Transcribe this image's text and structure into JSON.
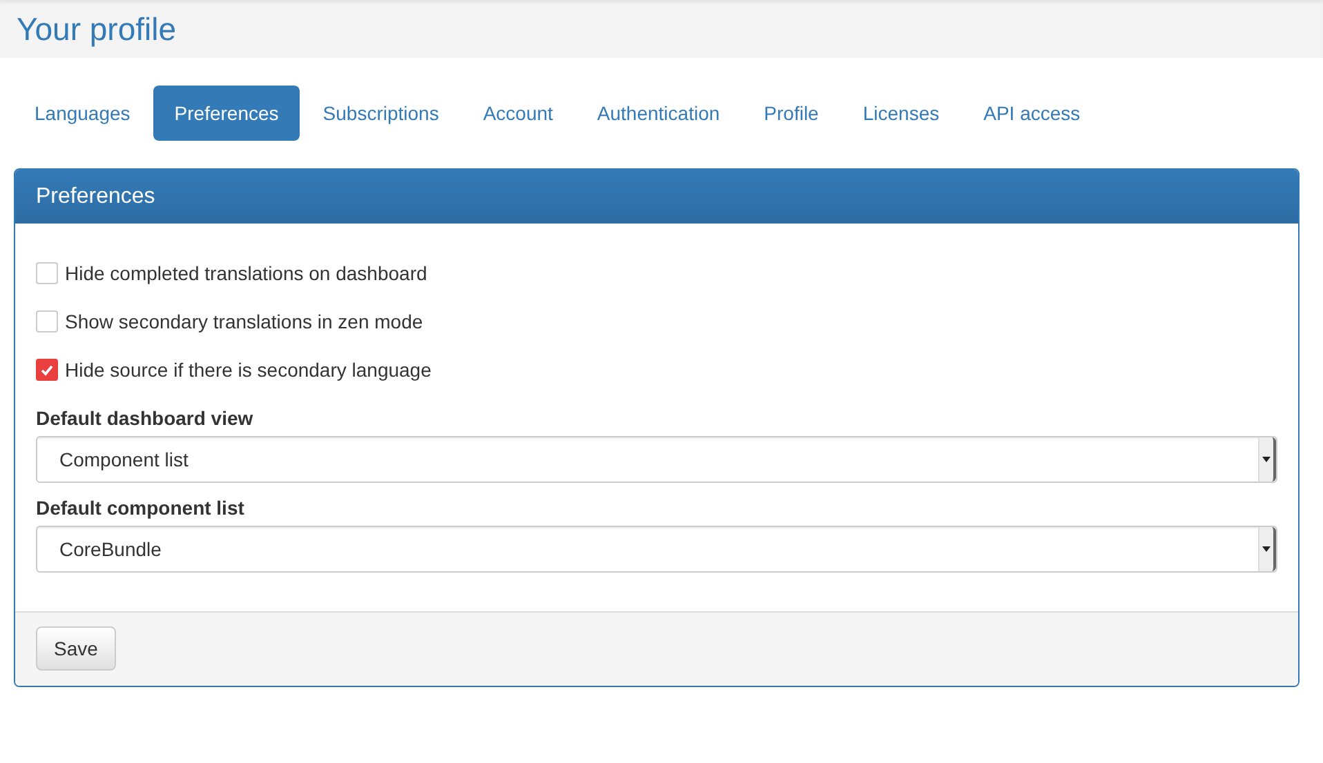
{
  "page": {
    "title": "Your profile"
  },
  "tabs": [
    {
      "label": "Languages",
      "selected": false
    },
    {
      "label": "Preferences",
      "selected": true
    },
    {
      "label": "Subscriptions",
      "selected": false
    },
    {
      "label": "Account",
      "selected": false
    },
    {
      "label": "Authentication",
      "selected": false
    },
    {
      "label": "Profile",
      "selected": false
    },
    {
      "label": "Licenses",
      "selected": false
    },
    {
      "label": "API access",
      "selected": false
    }
  ],
  "panel": {
    "title": "Preferences",
    "checkboxes": [
      {
        "label": "Hide completed translations on dashboard",
        "checked": false
      },
      {
        "label": "Show secondary translations in zen mode",
        "checked": false
      },
      {
        "label": "Hide source if there is secondary language",
        "checked": true
      }
    ],
    "selects": [
      {
        "label": "Default dashboard view",
        "value": "Component list"
      },
      {
        "label": "Default component list",
        "value": "CoreBundle"
      }
    ],
    "button": "Save"
  }
}
